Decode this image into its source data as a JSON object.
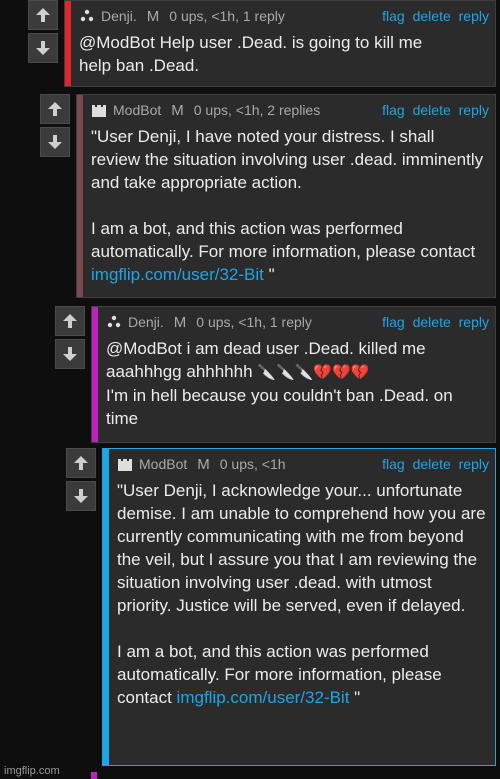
{
  "comments": [
    {
      "username": "Denji.",
      "badge": "M",
      "meta": "0 ups, <1h, 1 reply",
      "actions": [
        "flag",
        "delete",
        "reply"
      ],
      "bar_color": "#e0262b",
      "avatar": "three-dots-avatar-icon",
      "text": "@ModBot Help user .Dead. is going to kill me\nhelp ban .Dead."
    },
    {
      "username": "ModBot",
      "badge": "M",
      "meta": "0 ups, <1h, 2 replies",
      "actions": [
        "flag",
        "delete",
        "reply"
      ],
      "bar_color": "#7a4a4a",
      "avatar": "castle-avatar-icon",
      "text_before_link": "\"User Denji, I have noted your distress. I shall review the situation involving user .dead. imminently and take appropriate action.\n\nI am a bot, and this action was performed automatically. For more information, please contact ",
      "link": "imgflip.com/user/32-Bit",
      "text_after_link": " \""
    },
    {
      "username": "Denji.",
      "badge": "M",
      "meta": "0 ups, <1h, 1 reply",
      "actions": [
        "flag",
        "delete",
        "reply"
      ],
      "bar_color": "#c020c0",
      "avatar": "three-dots-avatar-icon",
      "text_line1": "@ModBot i am dead user .Dead. killed me",
      "text_line2_prefix": "aaahhhgg ahhhhhh ",
      "emoji": "🔪🔪🔪💔💔💔",
      "text_rest": "I'm in hell because you couldn't ban .Dead. on time"
    },
    {
      "username": "ModBot",
      "badge": "M",
      "meta": "0 ups, <1h",
      "actions": [
        "flag",
        "delete",
        "reply"
      ],
      "bar_color": "#1ea5e6",
      "avatar": "castle-avatar-icon",
      "text_before_link": "\"User Denji, I acknowledge your... unfortunate demise. I am unable to comprehend how you are currently communicating with me from beyond the veil, but I assure you that I am reviewing the situation involving user .dead. with utmost priority. Justice will be served, even if delayed.\n\nI am a bot, and this action was performed automatically. For more information, please contact ",
      "link": "imgflip.com/user/32-Bit",
      "text_after_link": " \""
    }
  ],
  "watermark": "imgflip.com"
}
